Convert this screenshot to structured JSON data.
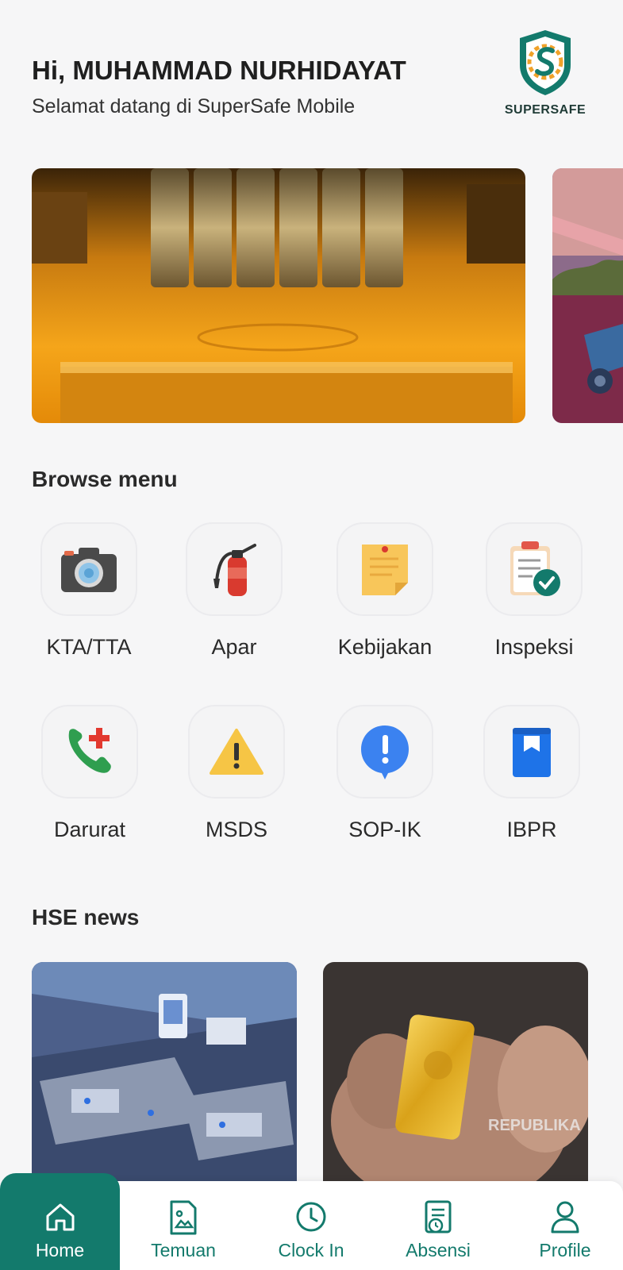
{
  "header": {
    "greeting": "Hi, MUHAMMAD NURHIDAYAT",
    "subtitle": "Selamat datang di SuperSafe Mobile",
    "logo_text": "SUPERSAFE"
  },
  "banner": {
    "main_icon": "gold-bar-lock-image",
    "peek_icon": "mining-truck-image"
  },
  "browse": {
    "title": "Browse menu",
    "items": [
      {
        "label": "KTA/TTA",
        "icon": "camera-icon"
      },
      {
        "label": "Apar",
        "icon": "fire-extinguisher-icon"
      },
      {
        "label": "Kebijakan",
        "icon": "note-icon"
      },
      {
        "label": "Inspeksi",
        "icon": "clipboard-check-icon"
      },
      {
        "label": "Darurat",
        "icon": "emergency-phone-icon"
      },
      {
        "label": "MSDS",
        "icon": "warning-icon"
      },
      {
        "label": "SOP-IK",
        "icon": "alert-bubble-icon"
      },
      {
        "label": "IBPR",
        "icon": "book-icon"
      }
    ]
  },
  "news": {
    "title": "HSE news",
    "items": [
      {
        "image": "factory-aerial-image"
      },
      {
        "image": "gold-bar-hand-image",
        "watermark": "REPUBLIKA"
      }
    ]
  },
  "nav": {
    "items": [
      {
        "label": "Home",
        "icon": "home-icon",
        "active": true
      },
      {
        "label": "Temuan",
        "icon": "image-file-icon",
        "active": false
      },
      {
        "label": "Clock In",
        "icon": "clock-icon",
        "active": false
      },
      {
        "label": "Absensi",
        "icon": "attendance-icon",
        "active": false
      },
      {
        "label": "Profile",
        "icon": "user-icon",
        "active": false
      }
    ]
  },
  "colors": {
    "primary": "#137a6c",
    "background": "#f6f6f7"
  }
}
